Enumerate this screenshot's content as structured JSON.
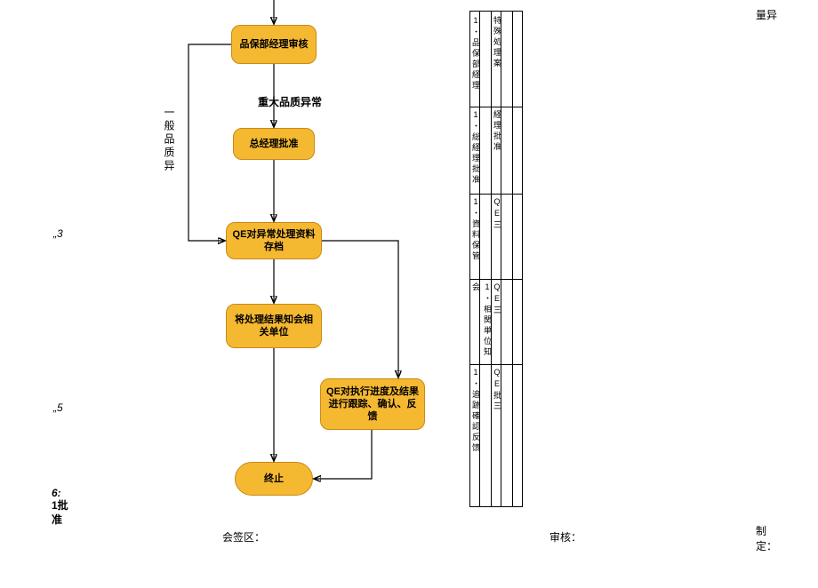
{
  "chart_data": {
    "type": "flowchart",
    "nodes": [
      {
        "id": "n1",
        "label": "品保部经理审核",
        "shape": "process"
      },
      {
        "id": "n2",
        "label": "总经理批准",
        "shape": "process"
      },
      {
        "id": "n3",
        "label": "QE对异常处理资料存档",
        "shape": "process"
      },
      {
        "id": "n4",
        "label": "将处理结果知会相关单位",
        "shape": "process"
      },
      {
        "id": "n5",
        "label": "QE对执行进度及结果进行跟踪、确认、反馈",
        "shape": "process"
      },
      {
        "id": "n6",
        "label": "终止",
        "shape": "terminator"
      }
    ],
    "edges": [
      {
        "from": "top",
        "to": "n1"
      },
      {
        "from": "n1",
        "to": "n2",
        "label": "重大品质异常"
      },
      {
        "from": "n1",
        "to": "n3",
        "label": "一般品质异",
        "routing": "left-loop"
      },
      {
        "from": "n2",
        "to": "n3"
      },
      {
        "from": "n3",
        "to": "n4"
      },
      {
        "from": "n3",
        "to": "n5",
        "routing": "right-branch"
      },
      {
        "from": "n4",
        "to": "n6"
      },
      {
        "from": "n5",
        "to": "n6"
      }
    ]
  },
  "labels": {
    "major_anomaly": "重大品质异常",
    "general_anomaly": "一般品质异",
    "top_right": "量异",
    "left_3": "„3",
    "left_5": "„5",
    "left_6": "6:",
    "left_approve": "1批准",
    "sign_area": "会签区：",
    "review": "审核：",
    "establish": "制定："
  },
  "side_fragments": {
    "row1a": "1・品保部経理",
    "row1b": "特殊処理案",
    "row2a": "1・総経理批准",
    "row2b": "経理批准",
    "row3a": "1・資料保管",
    "row3b": "QE三",
    "row4a": "1・相関単位知会",
    "row4b": "QE三",
    "row5a": "1・追跡確認反馈",
    "row5b": "QE批三"
  }
}
